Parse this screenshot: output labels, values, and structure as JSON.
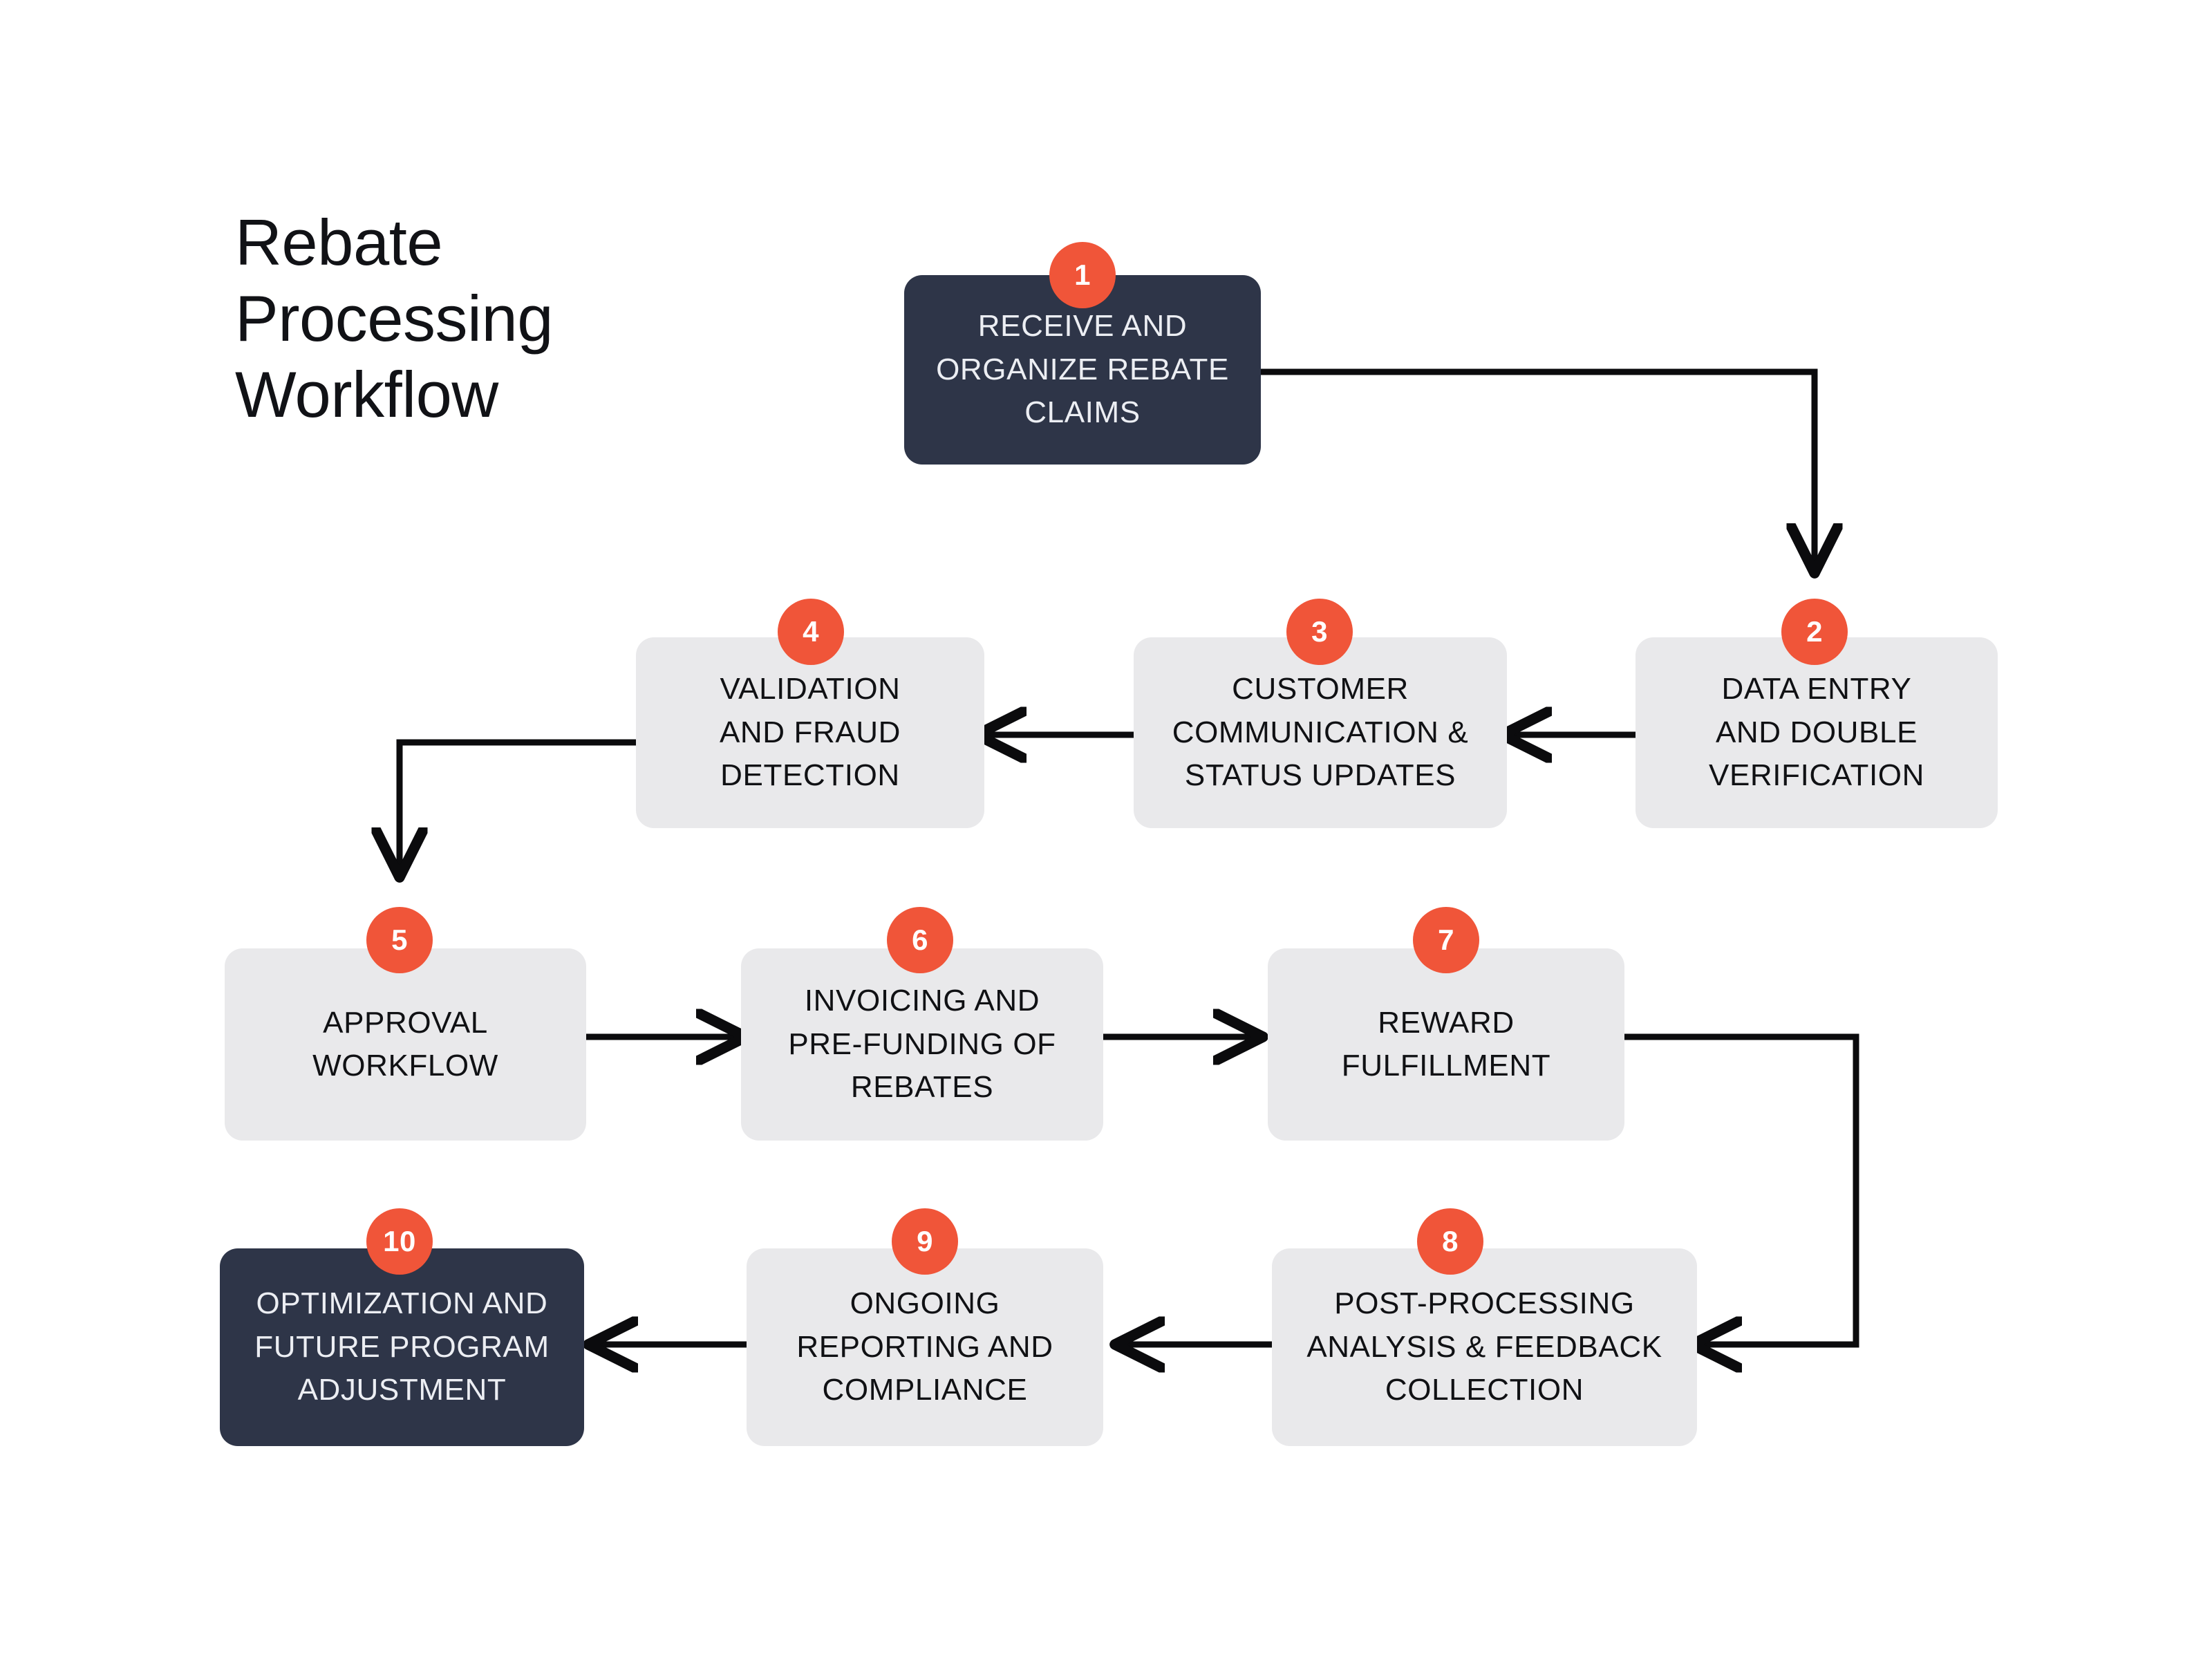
{
  "title": "Rebate\nProcessing\nWorkflow",
  "colors": {
    "accent": "#f05539",
    "dark_node": "#2e3548",
    "light_node": "#e9e9eb",
    "connector": "#0b0b0d",
    "background": "#ffffff",
    "dark_node_text": "#eceef3",
    "light_node_text": "#101114"
  },
  "steps": [
    {
      "number": "1",
      "label": "RECEIVE AND\nORGANIZE REBATE\nCLAIMS",
      "style": "dark"
    },
    {
      "number": "2",
      "label": "DATA ENTRY\nAND DOUBLE\nVERIFICATION",
      "style": "light"
    },
    {
      "number": "3",
      "label": "CUSTOMER\nCOMMUNICATION &\nSTATUS UPDATES",
      "style": "light"
    },
    {
      "number": "4",
      "label": "VALIDATION\nAND FRAUD\nDETECTION",
      "style": "light"
    },
    {
      "number": "5",
      "label": "APPROVAL\nWORKFLOW",
      "style": "light"
    },
    {
      "number": "6",
      "label": "INVOICING AND\nPRE-FUNDING OF\nREBATES",
      "style": "light"
    },
    {
      "number": "7",
      "label": "REWARD\nFULFILLMENT",
      "style": "light"
    },
    {
      "number": "8",
      "label": "POST-PROCESSING\nANALYSIS & FEEDBACK\nCOLLECTION",
      "style": "light"
    },
    {
      "number": "9",
      "label": "ONGOING\nREPORTING AND\nCOMPLIANCE",
      "style": "light"
    },
    {
      "number": "10",
      "label": "OPTIMIZATION AND\nFUTURE PROGRAM\nADJUSTMENT",
      "style": "dark"
    }
  ],
  "flow_order": [
    "1",
    "2",
    "3",
    "4",
    "5",
    "6",
    "7",
    "8",
    "9",
    "10"
  ]
}
